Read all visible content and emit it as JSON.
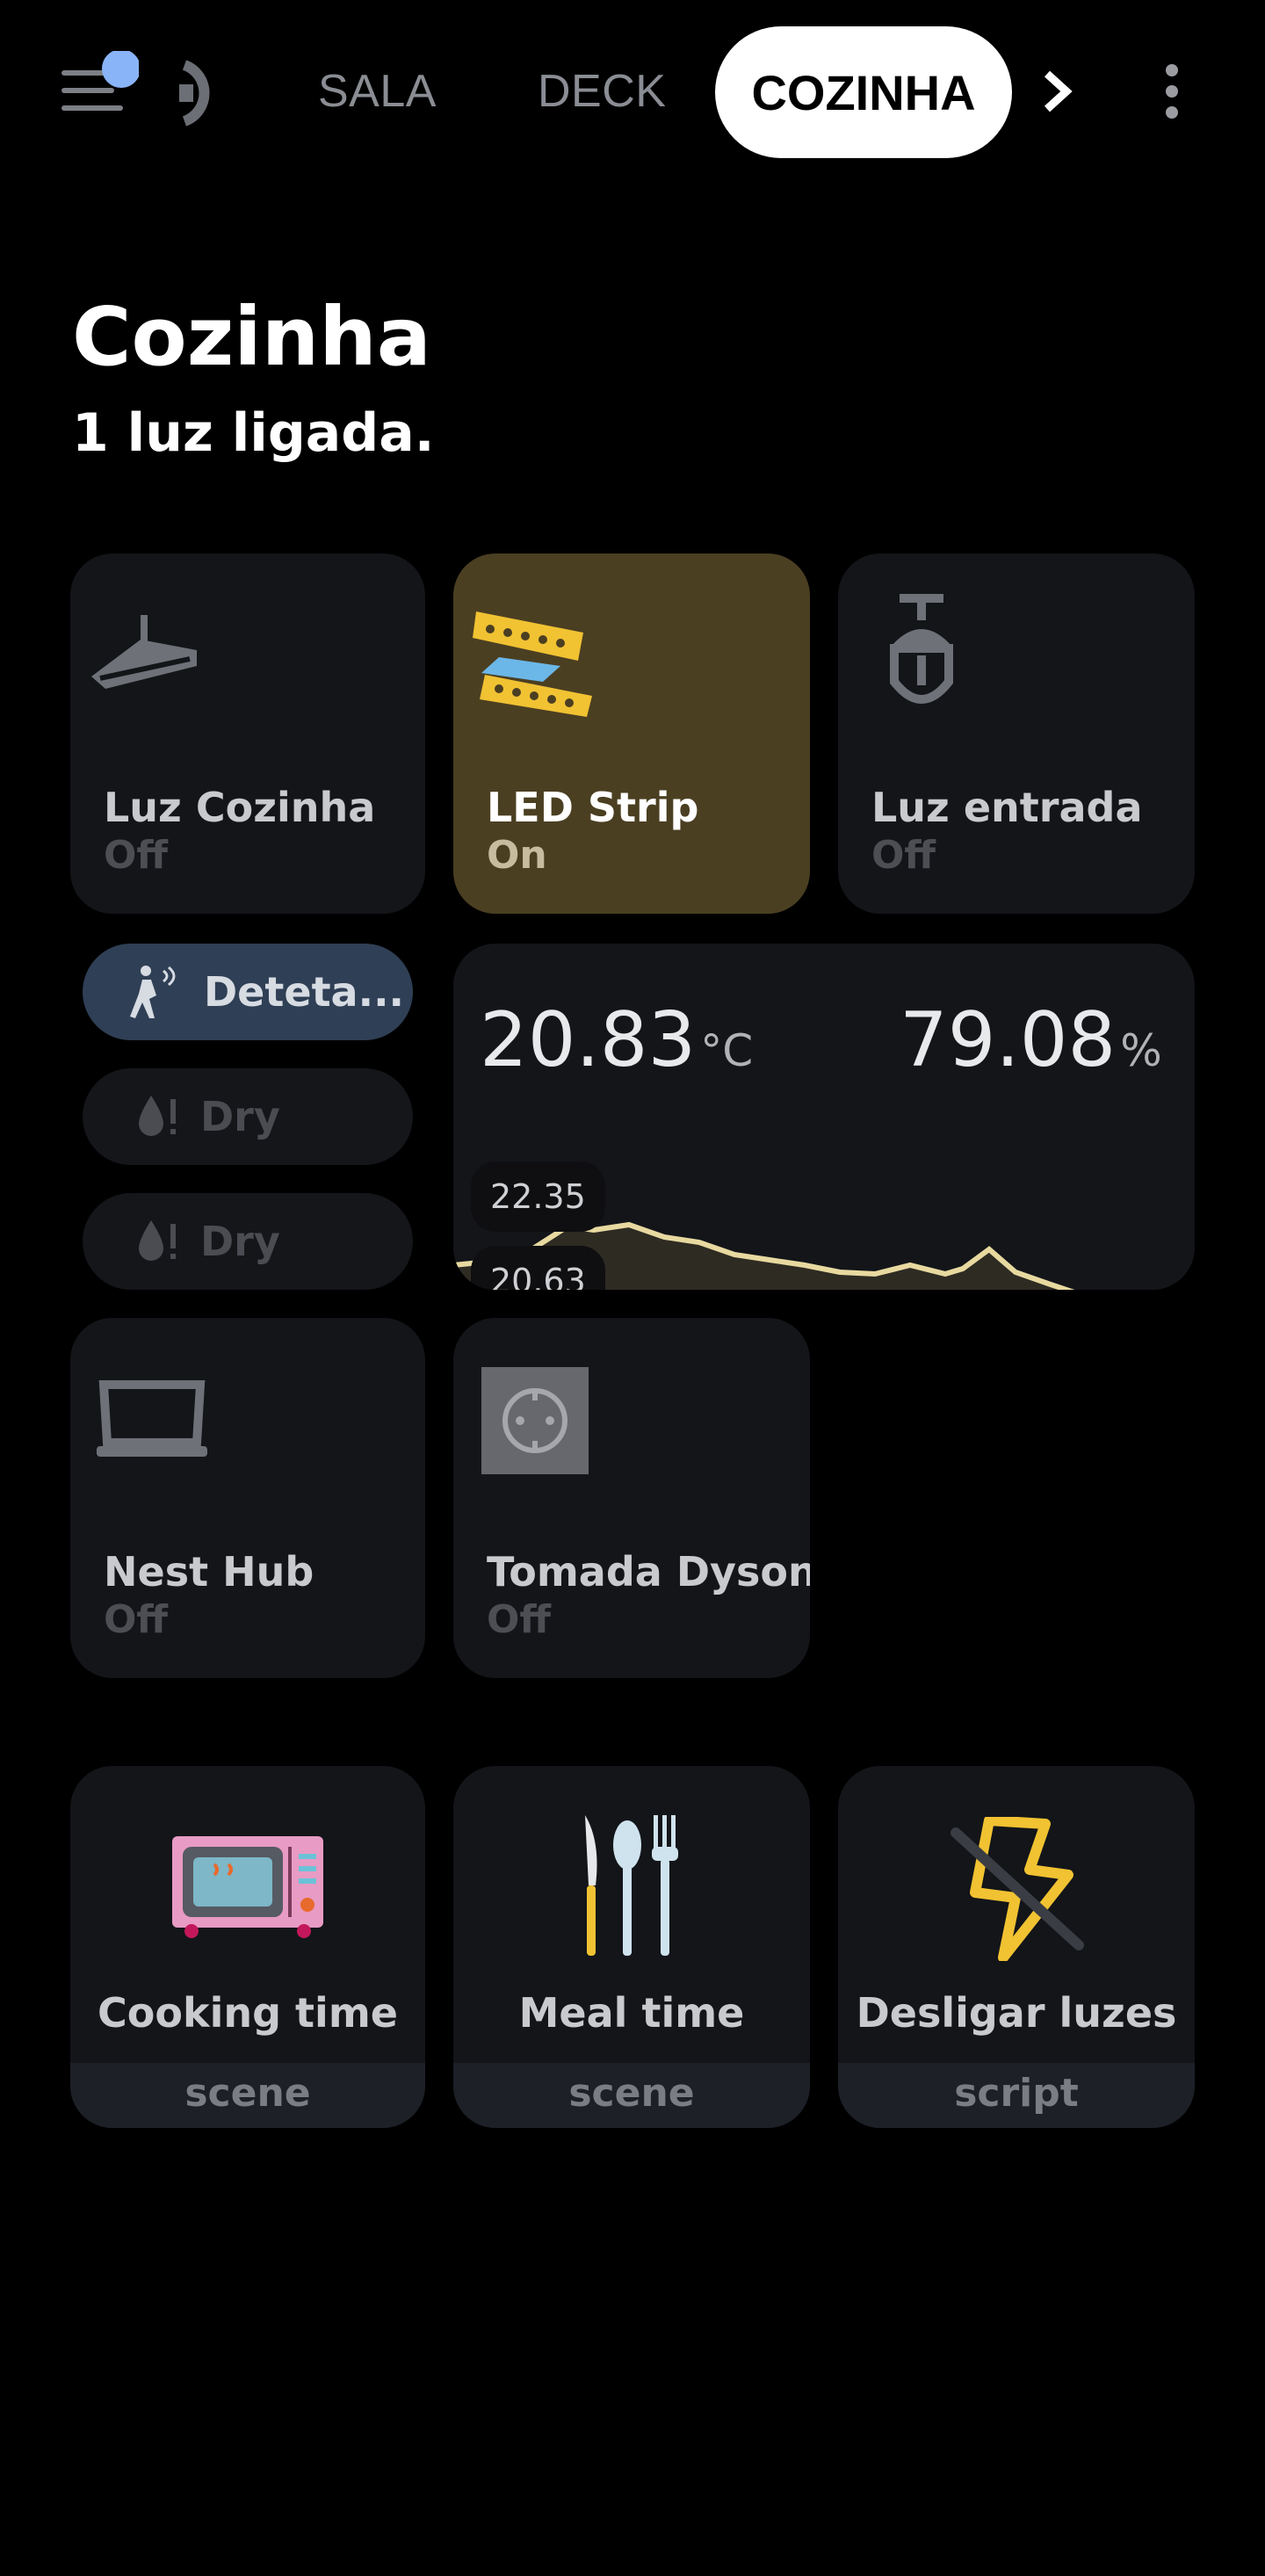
{
  "header": {
    "tabs": [
      "SALA",
      "DECK",
      "COZINHA"
    ],
    "active_tab": "COZINHA"
  },
  "page": {
    "title": "Cozinha",
    "subtitle": "1 luz ligada."
  },
  "lights": [
    {
      "name": "Luz Cozinha",
      "state": "Off"
    },
    {
      "name": "LED Strip",
      "state": "On"
    },
    {
      "name": "Luz entrada",
      "state": "Off"
    }
  ],
  "sensors": {
    "motion": "Deteta...",
    "leak1": "Dry",
    "leak2": "Dry"
  },
  "climate": {
    "temperature": "20.83",
    "temperature_unit": "°C",
    "humidity": "79.08",
    "humidity_unit": "%",
    "tooltip_max": "22.35",
    "tooltip_min": "20.63",
    "line_color": "#e8d9a0"
  },
  "devices": [
    {
      "name": "Nest Hub",
      "state": "Off"
    },
    {
      "name": "Tomada Dyson",
      "state": "Off"
    }
  ],
  "scenes": [
    {
      "name": "Cooking time",
      "type": "scene"
    },
    {
      "name": "Meal time",
      "type": "scene"
    },
    {
      "name": "Desligar luzes",
      "type": "script"
    }
  ],
  "colors": {
    "accent_on": "#4b3f22",
    "card_bg": "#131519",
    "chip_active": "#2f3f55",
    "badge_dot": "#8ab4f8"
  }
}
